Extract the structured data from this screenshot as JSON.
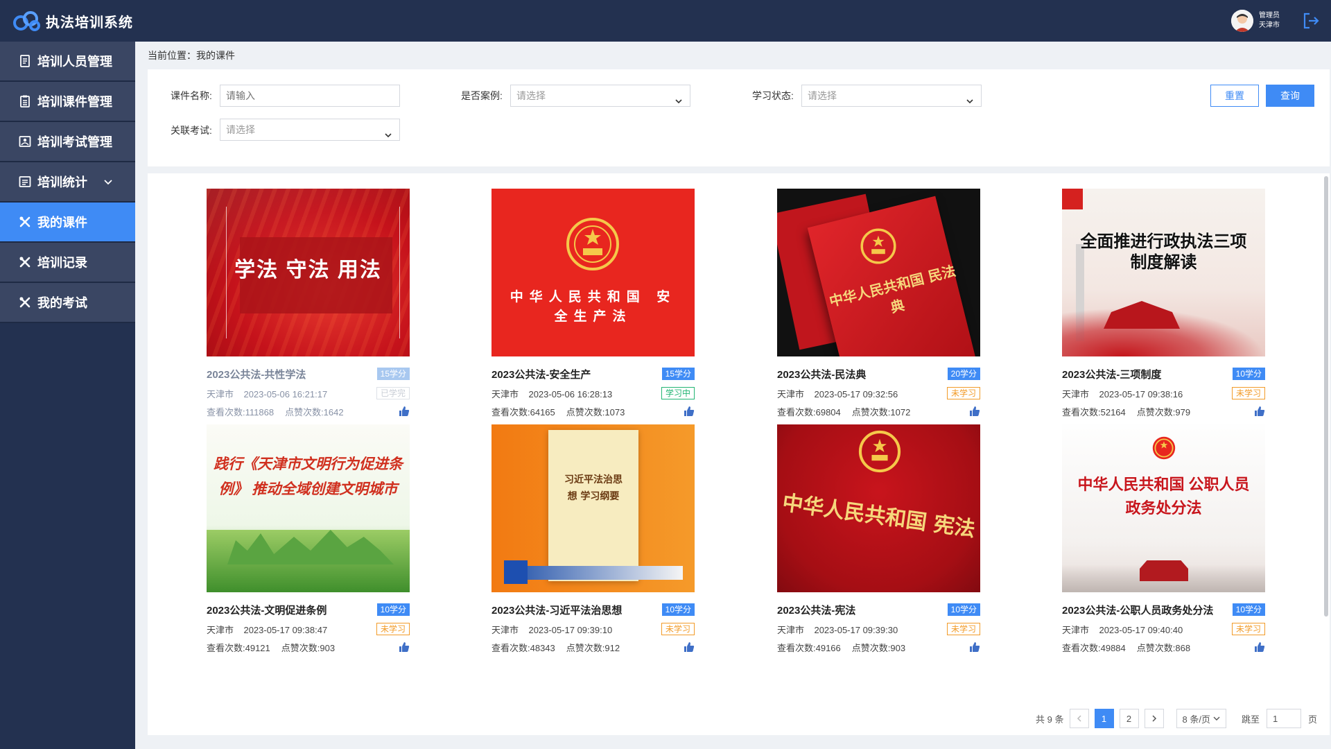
{
  "header": {
    "app_title": "执法培训系统",
    "user_role": "管理员",
    "user_city": "天津市"
  },
  "sidebar": {
    "items": [
      {
        "label": "培训人员管理",
        "icon": "document-icon"
      },
      {
        "label": "培训课件管理",
        "icon": "clipboard-icon"
      },
      {
        "label": "培训考试管理",
        "icon": "image-icon"
      },
      {
        "label": "培训统计",
        "icon": "chart-icon",
        "expandable": true
      },
      {
        "label": "我的课件",
        "icon": "tools-icon",
        "active": true
      },
      {
        "label": "培训记录",
        "icon": "tools-icon"
      },
      {
        "label": "我的考试",
        "icon": "tools-icon"
      }
    ]
  },
  "breadcrumb": {
    "prefix": "当前位置：",
    "current": "我的课件"
  },
  "filters": {
    "course_name_label": "课件名称:",
    "course_name_placeholder": "请输入",
    "is_case_label": "是否案例:",
    "is_case_value": "请选择",
    "study_status_label": "学习状态:",
    "study_status_value": "请选择",
    "exam_label": "关联考试:",
    "exam_value": "请选择",
    "reset_label": "重置",
    "query_label": "查询"
  },
  "courses": [
    {
      "title": "2023公共法-共性学法",
      "credit": "15学分",
      "city": "天津市",
      "date": "2023-05-06 16:21:17",
      "status": "已学完",
      "views": "查看次数:111868",
      "likes": "点赞次数:1642",
      "thumb_text": "学法 守法 用法"
    },
    {
      "title": "2023公共法-安全生产",
      "credit": "15学分",
      "city": "天津市",
      "date": "2023-05-06 16:28:13",
      "status": "学习中",
      "views": "查看次数:64165",
      "likes": "点赞次数:1073",
      "thumb_text": "中华人民共和国 安全生产法"
    },
    {
      "title": "2023公共法-民法典",
      "credit": "20学分",
      "city": "天津市",
      "date": "2023-05-17 09:32:56",
      "status": "未学习",
      "views": "查看次数:69804",
      "likes": "点赞次数:1072",
      "thumb_text": "中华人民共和国 民法典"
    },
    {
      "title": "2023公共法-三项制度",
      "credit": "10学分",
      "city": "天津市",
      "date": "2023-05-17 09:38:16",
      "status": "未学习",
      "views": "查看次数:52164",
      "likes": "点赞次数:979",
      "thumb_text": "全面推进行政执法三项制度解读"
    },
    {
      "title": "2023公共法-文明促进条例",
      "credit": "10学分",
      "city": "天津市",
      "date": "2023-05-17 09:38:47",
      "status": "未学习",
      "views": "查看次数:49121",
      "likes": "点赞次数:903",
      "thumb_text": "践行《天津市文明行为促进条例》 推动全域创建文明城市"
    },
    {
      "title": "2023公共法-习近平法治思想",
      "credit": "10学分",
      "city": "天津市",
      "date": "2023-05-17 09:39:10",
      "status": "未学习",
      "views": "查看次数:48343",
      "likes": "点赞次数:912",
      "thumb_text": "习近平法治思想 学习纲要"
    },
    {
      "title": "2023公共法-宪法",
      "credit": "10学分",
      "city": "天津市",
      "date": "2023-05-17 09:39:30",
      "status": "未学习",
      "views": "查看次数:49166",
      "likes": "点赞次数:903",
      "thumb_text": "中华人民共和国 宪法"
    },
    {
      "title": "2023公共法-公职人员政务处分法",
      "credit": "10学分",
      "city": "天津市",
      "date": "2023-05-17 09:40:40",
      "status": "未学习",
      "views": "查看次数:49884",
      "likes": "点赞次数:868",
      "thumb_text": "中华人民共和国 公职人员政务处分法"
    }
  ],
  "pagination": {
    "total": "共 9 条",
    "page1": "1",
    "page2": "2",
    "page_size": "8 条/页",
    "jump_label": "跳至",
    "jump_value": "1",
    "page_suffix": "页"
  },
  "colors": {
    "header_bg": "#233150",
    "accent": "#3f8bf5",
    "unlearned": "#f29b28",
    "learning": "#22b573"
  }
}
